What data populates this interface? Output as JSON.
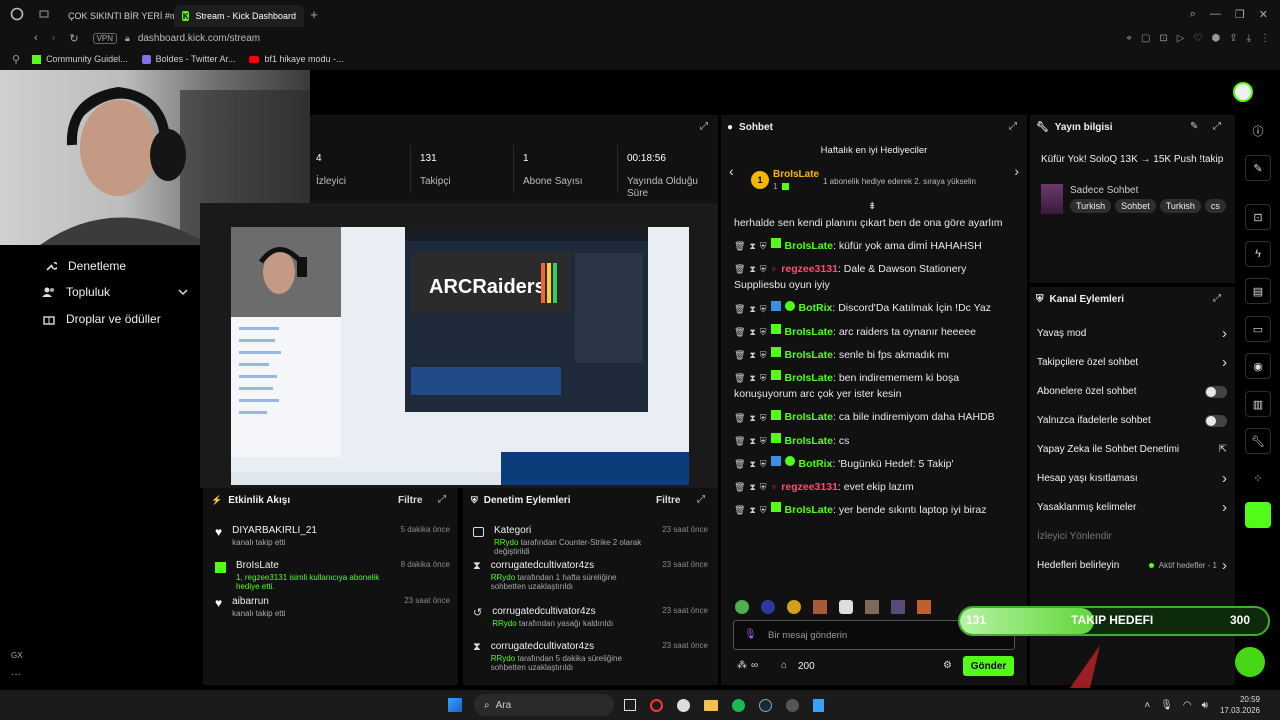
{
  "browser": {
    "tabs": [
      {
        "label": "ÇOK SIKINTI BİR YERİ #mi",
        "active": false
      },
      {
        "label": "Stream - Kick Dashboard",
        "active": true
      }
    ],
    "address": "dashboard.kick.com/stream",
    "vpn": "VPN",
    "bookmarks": [
      "Community Guidel...",
      "Boldes - Twitter Ar...",
      "bf1 hikaye modu -..."
    ]
  },
  "sidebar": {
    "items": [
      {
        "label": "Denetleme",
        "icon": "wrench-icon"
      },
      {
        "label": "Topluluk",
        "icon": "users-icon"
      },
      {
        "label": "Droplar ve ödüller",
        "icon": "gift-icon"
      }
    ],
    "footer_label": "GX"
  },
  "stats": [
    {
      "value": "4",
      "label": "İzleyici"
    },
    {
      "value": "131",
      "label": "Takipçi"
    },
    {
      "value": "1",
      "label": "Abone Sayısı"
    },
    {
      "value": "00:18:56",
      "label": "Yayında Olduğu Süre"
    }
  ],
  "chat": {
    "title": "Sohbet",
    "gifters_title": "Haftalık en iyi Hediyeciler",
    "top_gifter": {
      "rank": "1",
      "name": "BroIsLate",
      "count": "1",
      "note": "1 abonelik hediye ederek 2. sıraya yükselin"
    },
    "messages": [
      {
        "user": "",
        "text": "herhalde sen kendi planını çıkart ben de ona göre ayarlım",
        "color": "#e8e8e8",
        "continuation": true
      },
      {
        "user": "BroIsLate",
        "text": "küfür yok ama dimİ HAHAHSH",
        "color": "#53fc18"
      },
      {
        "user": "regzee3131",
        "text": "Dale & Dawson Stationery Suppliesbu oyun iyiy",
        "color": "#ff4b6e"
      },
      {
        "user": "BotRix",
        "text": "Discord'Da Katılmak İçin !Dc Yaz",
        "color": "#53fc18",
        "bot": true
      },
      {
        "user": "BroIsLate",
        "text": "arc raiders ta oynanır heeeee",
        "color": "#53fc18"
      },
      {
        "user": "BroIsLate",
        "text": "senle bi fps akmadık mı",
        "color": "#53fc18"
      },
      {
        "user": "BroIsLate",
        "text": "ben indirememem ki boşa konuşuyorum arc çok yer ister kesin",
        "color": "#53fc18"
      },
      {
        "user": "BroIsLate",
        "text": "ca bile indiremiyom daha HAHDB",
        "color": "#53fc18"
      },
      {
        "user": "BroIsLate",
        "text": "cs",
        "color": "#53fc18"
      },
      {
        "user": "BotRix",
        "text": "'Bugünkü Hedef: 5 Takip'",
        "color": "#53fc18",
        "bot": true
      },
      {
        "user": "regzee3131",
        "text": "evet ekip lazım",
        "color": "#ff4b6e"
      },
      {
        "user": "BroIsLate",
        "text": "yer bende sıkıntı laptop iyi biraz",
        "color": "#53fc18"
      }
    ],
    "input_placeholder": "Bir mesaj gönderin",
    "points": "200",
    "send_label": "Gönder"
  },
  "stream_info": {
    "title": "Yayın bilgisi",
    "stream_title": "Küfür Yok! SoloQ 13K → 15K Push !takip",
    "category": "Sadece Sohbet",
    "tags": [
      "Turkish",
      "Sohbet",
      "Turkish",
      "cs"
    ]
  },
  "channel_actions": {
    "title": "Kanal Eylemleri",
    "rows": [
      {
        "label": "Yavaş mod",
        "control": "chevron"
      },
      {
        "label": "Takipçilere özel sohbet",
        "control": "chevron"
      },
      {
        "label": "Abonelere özel sohbet",
        "control": "toggle"
      },
      {
        "label": "Yalnızca ifadelerle sohbet",
        "control": "toggle"
      },
      {
        "label": "Yapay Zeka ile Sohbet Denetimi",
        "control": "external"
      },
      {
        "label": "Hesap yaşı kısıtlaması",
        "control": "chevron"
      },
      {
        "label": "Yasaklanmış kelimeler",
        "control": "chevron"
      },
      {
        "label": "İzleyici Yönlendir",
        "control": "none",
        "muted": true
      },
      {
        "label": "Hedefleri belirleyin",
        "control": "chevron",
        "extra": "Aktif hedefler - 1"
      }
    ]
  },
  "activity": {
    "title": "Etkinlik Akışı",
    "filter": "Filtre",
    "items": [
      {
        "icon": "heart-icon",
        "user": "DIYARBAKIRLI_21",
        "sub": "kanalı takip etti",
        "time": "5 dakika önce"
      },
      {
        "icon": "gift-icon",
        "user": "BroIsLate",
        "sub": "1, regzee3131 isimli kullanıcıya abonelik hediye etti.",
        "time": "8 dakika önce"
      },
      {
        "icon": "heart-icon",
        "user": "aibarrun",
        "sub": "kanalı takip etti",
        "time": "23 saat önce"
      }
    ]
  },
  "moderation": {
    "title": "Denetim Eylemleri",
    "filter": "Filtre",
    "items": [
      {
        "icon": "category-icon",
        "user": "Kategori",
        "actor": "RRydo",
        "sub": "tarafından Counter-Strike 2 olarak değiştirildi",
        "time": "23 saat önce"
      },
      {
        "icon": "hourglass-icon",
        "user": "corrugatedcultivator4zs",
        "actor": "RRydo",
        "sub": "tarafından 1 hafta süreliğine sohbetten uzaklaştırıldı",
        "time": "23 saat önce"
      },
      {
        "icon": "undo-icon",
        "user": "corrugatedcultivator4zs",
        "actor": "RRydo",
        "sub": "tarafından yasağı kaldırıldı",
        "time": "23 saat önce"
      },
      {
        "icon": "hourglass-icon",
        "user": "corrugatedcultivator4zs",
        "actor": "RRydo",
        "sub": "tarafından 5 dakika süreliğine sohbetten uzaklaştırıldı",
        "time": "23 saat önce"
      }
    ]
  },
  "goal_overlay": {
    "current": "131",
    "label": "TAKIP HEDEFI",
    "target": "300"
  },
  "taskbar": {
    "search": "Ara",
    "time": "20:59",
    "date": "17.03.2026"
  },
  "colors": {
    "accent": "#53fc18",
    "panel": "#111111",
    "bg": "#000000",
    "mod_red": "#ff4b6e"
  }
}
